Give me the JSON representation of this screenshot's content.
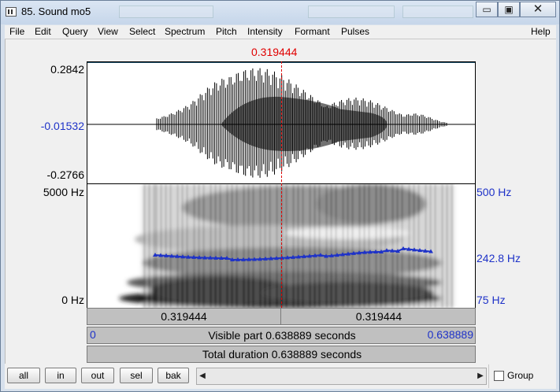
{
  "window": {
    "title": "85. Sound mo5",
    "minimize_glyph": "▭",
    "maximize_glyph": "▣",
    "close_glyph": "✕"
  },
  "menu": [
    "File",
    "Edit",
    "Query",
    "View",
    "Select",
    "Spectrum",
    "Pitch",
    "Intensity",
    "Formant",
    "Pulses"
  ],
  "help_label": "Help",
  "cursor": {
    "time_label": "0.319444",
    "color": "#e00000"
  },
  "waveform": {
    "ymax_label": "0.2842",
    "ycursor_label": "-0.01532",
    "ymin_label": "-0.2766"
  },
  "spectrogram": {
    "freq_max_label": "5000 Hz",
    "freq_min_label": "0 Hz",
    "pitch_max_label": "500 Hz",
    "pitch_cursor_label": "242.8 Hz",
    "pitch_min_label": "75 Hz",
    "pitch_color": "#1e32c8"
  },
  "time_bar": {
    "left_label": "0.319444",
    "right_label": "0.319444"
  },
  "visible_bar": {
    "start_label": "0",
    "text": "Visible part 0.638889 seconds",
    "end_label": "0.638889"
  },
  "total_bar": {
    "text": "Total duration 0.638889 seconds"
  },
  "buttons": {
    "all": "all",
    "in": "in",
    "out": "out",
    "sel": "sel",
    "bak": "bak"
  },
  "scroll": {
    "left_arrow": "◀",
    "right_arrow": "▶"
  },
  "group_label": "Group"
}
